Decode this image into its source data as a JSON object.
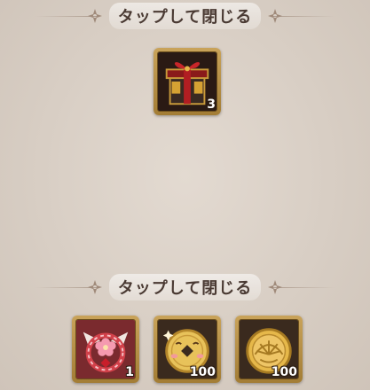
{
  "close_banner_top": {
    "label": "タップして閉じる"
  },
  "reward_top": {
    "icon": "gift-box-icon",
    "count": "3"
  },
  "close_banner_bottom": {
    "label": "タップして閉じる"
  },
  "rewards_bottom": [
    {
      "icon": "sakura-charm-icon",
      "count": "1"
    },
    {
      "icon": "smiling-coin-icon",
      "count": "100"
    },
    {
      "icon": "gold-coin-icon",
      "count": "100"
    }
  ],
  "colors": {
    "background": "#d9cfc6",
    "frame_gold": "#c9a35a",
    "banner_text": "#4a3a33"
  }
}
